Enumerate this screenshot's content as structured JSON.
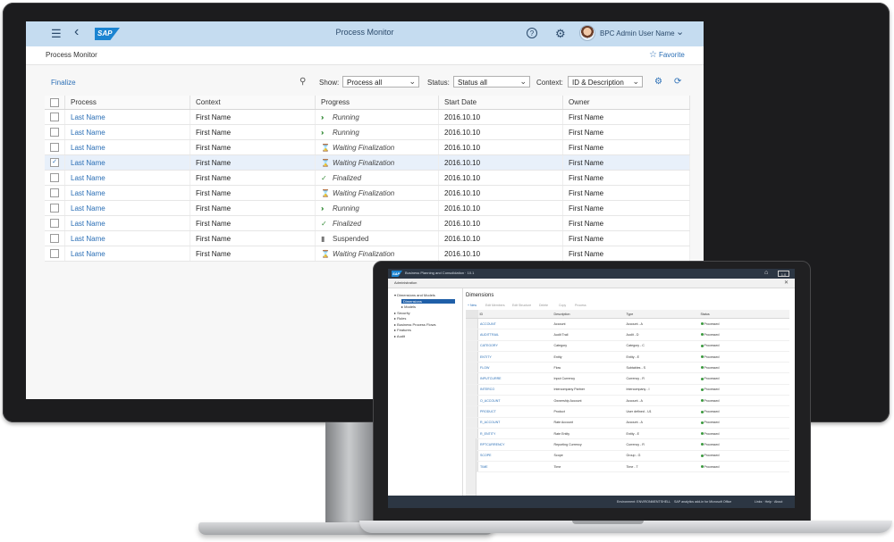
{
  "desktop": {
    "shell": {
      "title": "Process Monitor",
      "logo_text": "SAP",
      "user_name": "BPC Admin User Name",
      "icons": [
        "hamburger-icon",
        "back-icon",
        "help-icon",
        "gear-icon",
        "chevron-down-icon"
      ]
    },
    "subheader": {
      "page_title": "Process Monitor",
      "favorite_label": "Favorite"
    },
    "toolbar": {
      "finalize_label": "Finalize",
      "show_label": "Show:",
      "show_value": "Process all",
      "status_label": "Status:",
      "status_value": "Status all",
      "context_label": "Context:",
      "context_value": "ID & Description"
    },
    "table": {
      "columns": [
        "Process",
        "Context",
        "Progress",
        "Start Date",
        "Owner"
      ],
      "rows": [
        {
          "checked": false,
          "process": "Last Name",
          "context": "First Name",
          "progress": "Running",
          "progress_type": "running",
          "start_date": "2016.10.10",
          "owner": "First Name"
        },
        {
          "checked": false,
          "process": "Last Name",
          "context": "First Name",
          "progress": "Running",
          "progress_type": "running",
          "start_date": "2016.10.10",
          "owner": "First Name"
        },
        {
          "checked": false,
          "process": "Last Name",
          "context": "First Name",
          "progress": "Waiting Finalization",
          "progress_type": "waiting",
          "start_date": "2016.10.10",
          "owner": "First Name"
        },
        {
          "checked": true,
          "process": "Last Name",
          "context": "First Name",
          "progress": "Waiting Finalization",
          "progress_type": "waiting",
          "start_date": "2016.10.10",
          "owner": "First Name"
        },
        {
          "checked": false,
          "process": "Last Name",
          "context": "First Name",
          "progress": "Finalized",
          "progress_type": "finalized",
          "start_date": "2016.10.10",
          "owner": "First Name"
        },
        {
          "checked": false,
          "process": "Last Name",
          "context": "First Name",
          "progress": "Waiting Finalization",
          "progress_type": "waiting",
          "start_date": "2016.10.10",
          "owner": "First Name"
        },
        {
          "checked": false,
          "process": "Last Name",
          "context": "First Name",
          "progress": "Running",
          "progress_type": "running",
          "start_date": "2016.10.10",
          "owner": "First Name"
        },
        {
          "checked": false,
          "process": "Last Name",
          "context": "First Name",
          "progress": "Finalized",
          "progress_type": "finalized",
          "start_date": "2016.10.10",
          "owner": "First Name"
        },
        {
          "checked": false,
          "process": "Last Name",
          "context": "First Name",
          "progress": "Suspended",
          "progress_type": "suspended",
          "start_date": "2016.10.10",
          "owner": "First Name"
        },
        {
          "checked": false,
          "process": "Last Name",
          "context": "First Name",
          "progress": "Waiting Finalization",
          "progress_type": "waiting",
          "start_date": "2016.10.10",
          "owner": "First Name"
        }
      ]
    }
  },
  "laptop": {
    "shell": {
      "logo_text": "SAP",
      "title": "Business Planning and Consolidation · 10.1",
      "box_label": "1.0"
    },
    "admin_title": "Administration",
    "nav": [
      {
        "label": "▾ Dimensions and Models",
        "indent": 0,
        "selected": false
      },
      {
        "label": "Dimensions",
        "indent": 2,
        "selected": true
      },
      {
        "label": "▸ Models",
        "indent": 2,
        "selected": false
      },
      {
        "label": "▸ Security",
        "indent": 0,
        "selected": false
      },
      {
        "label": "▸ Rules",
        "indent": 0,
        "selected": false
      },
      {
        "label": "▸ Business Process Flows",
        "indent": 0,
        "selected": false
      },
      {
        "label": "▸ Features",
        "indent": 0,
        "selected": false
      },
      {
        "label": "▸ Audit",
        "indent": 0,
        "selected": false
      }
    ],
    "main_title": "Dimensions",
    "toolbar": [
      "+ New",
      "Edit Members",
      "Edit Structure",
      "Delete",
      "Copy",
      "Process"
    ],
    "columns": [
      "ID",
      "Description",
      "Type",
      "Status"
    ],
    "rows": [
      {
        "id": "ACCOUNT",
        "description": "Account",
        "type": "Account - A",
        "status": "Processed"
      },
      {
        "id": "AUDITTRAIL",
        "description": "Audit Trail",
        "type": "Audit - D",
        "status": "Processed"
      },
      {
        "id": "CATEGORY",
        "description": "Category",
        "type": "Category - C",
        "status": "Processed"
      },
      {
        "id": "ENTITY",
        "description": "Entity",
        "type": "Entity - E",
        "status": "Processed"
      },
      {
        "id": "FLOW",
        "description": "Flow",
        "type": "Subtables - S",
        "status": "Processed"
      },
      {
        "id": "INPUTCURRE",
        "description": "Input Currency",
        "type": "Currency - R",
        "status": "Processed"
      },
      {
        "id": "INTERCO",
        "description": "Intercompany Partner",
        "type": "Intercompany - I",
        "status": "Processed"
      },
      {
        "id": "O_ACCOUNT",
        "description": "Ownership Account",
        "type": "Account - A",
        "status": "Processed"
      },
      {
        "id": "PRODUCT",
        "description": "Product",
        "type": "User defined - U1",
        "status": "Processed"
      },
      {
        "id": "R_ACCOUNT",
        "description": "Rate Account",
        "type": "Account - A",
        "status": "Processed"
      },
      {
        "id": "R_ENTITY",
        "description": "Rate Entity",
        "type": "Entity - E",
        "status": "Processed"
      },
      {
        "id": "RPTCURRENCY",
        "description": "Reporting Currency",
        "type": "Currency - R",
        "status": "Processed"
      },
      {
        "id": "SCOPE",
        "description": "Scope",
        "type": "Group - G",
        "status": "Processed"
      },
      {
        "id": "TIME",
        "description": "Time",
        "type": "Time - T",
        "status": "Processed"
      }
    ],
    "status_bar": {
      "environment": "Environment: ENVIRONMENTSHELL",
      "addin": "SAP analytics add-in for Microsoft Office",
      "links": "Links · Help · About"
    }
  },
  "colors": {
    "shell_bar": "#c5dcf0",
    "link": "#2b6fb6",
    "success": "#3b8f3e",
    "bezel": "#1c1c1e"
  }
}
